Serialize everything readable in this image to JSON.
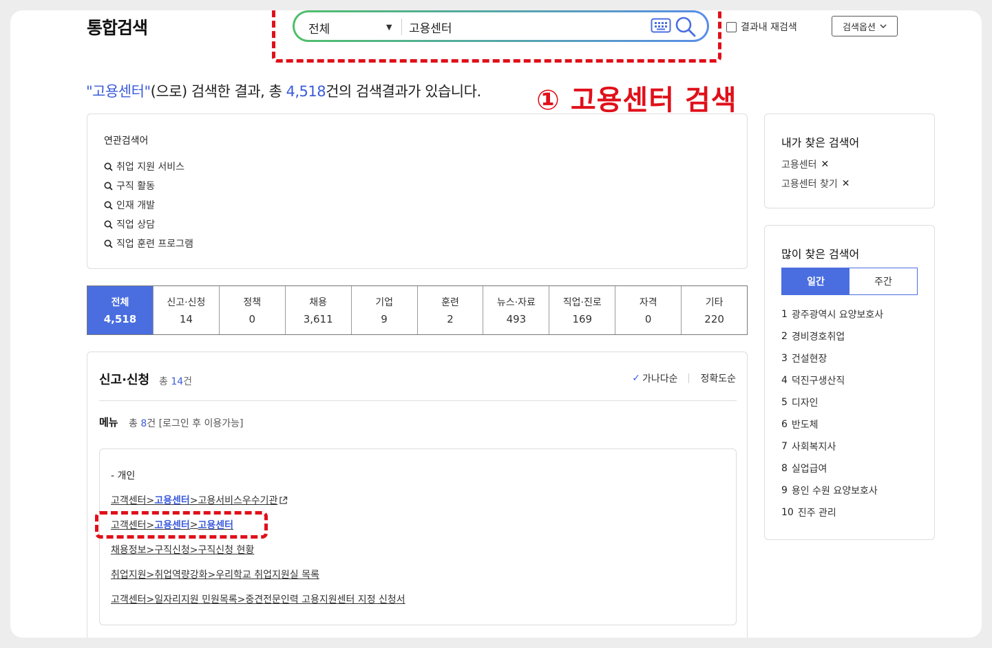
{
  "header": {
    "title": "통합검색",
    "search": {
      "scope": "전체",
      "query": "고용센터"
    },
    "research_label": "결과내 재검색",
    "options_label": "검색옵션"
  },
  "annotation": {
    "step_number": "①",
    "step_text": "고용센터 검색"
  },
  "summary": {
    "quote_open": "\"",
    "keyword": "고용센터",
    "quote_close": "\"",
    "text1": "(으로) 검색한 결과, 총 ",
    "total": "4,518",
    "text2": "건의 검색결과가 있습니다."
  },
  "related": {
    "title": "연관검색어",
    "items": [
      "취업 지원 서비스",
      "구직 활동",
      "인재 개발",
      "직업 상담",
      "직업 훈련 프로그램"
    ]
  },
  "tabs": [
    {
      "label": "전체",
      "count": "4,518"
    },
    {
      "label": "신고·신청",
      "count": "14"
    },
    {
      "label": "정책",
      "count": "0"
    },
    {
      "label": "채용",
      "count": "3,611"
    },
    {
      "label": "기업",
      "count": "9"
    },
    {
      "label": "훈련",
      "count": "2"
    },
    {
      "label": "뉴스·자료",
      "count": "493"
    },
    {
      "label": "직업·진로",
      "count": "169"
    },
    {
      "label": "자격",
      "count": "0"
    },
    {
      "label": "기타",
      "count": "220"
    }
  ],
  "results": {
    "section_title": "신고·신청",
    "section_prefix": "총 ",
    "section_count": "14",
    "section_suffix": "건",
    "sort": {
      "check": "✓",
      "option1": "가나다순",
      "option2": "정확도순"
    },
    "menu": {
      "title": "메뉴",
      "prefix": "총 ",
      "count": "8",
      "suffix": "건 [로그인 후 이용가능]"
    },
    "group_label": "- 개인",
    "links": [
      {
        "a": "고객센터>",
        "b": "고용센터",
        "c": ">고용서비스우수기관"
      },
      {
        "a": "고객센터>",
        "b": "고용센터",
        "c": ">",
        "d": "고용센터"
      },
      {
        "text": "채용정보>구직신청>구직신청 현황"
      },
      {
        "text": "취업지원>취업역량강화>우리학교 취업지원실 목록"
      },
      {
        "text": "고객센터>일자리지원 민원목록>중견전문인력 고용지원센터 지정 신청서"
      }
    ]
  },
  "my_keywords": {
    "title": "내가 찾은 검색어",
    "items": [
      "고용센터",
      "고용센터 찾기"
    ]
  },
  "popular_keywords": {
    "title": "많이 찾은 검색어",
    "toggle": [
      "일간",
      "주간"
    ],
    "items": [
      {
        "rank": "1",
        "text": "광주광역시 요양보호사"
      },
      {
        "rank": "2",
        "text": "경비경호취업"
      },
      {
        "rank": "3",
        "text": "건설현장"
      },
      {
        "rank": "4",
        "text": "덕진구생산직"
      },
      {
        "rank": "5",
        "text": "디자인"
      },
      {
        "rank": "6",
        "text": "반도체"
      },
      {
        "rank": "7",
        "text": "사회복지사"
      },
      {
        "rank": "8",
        "text": "실업급여"
      },
      {
        "rank": "9",
        "text": "용인 수원 요양보호사"
      },
      {
        "rank": "10",
        "text": "진주 관리"
      }
    ]
  },
  "colors": {
    "accent": "#4a6ee0",
    "annotation": "#e0101a"
  }
}
